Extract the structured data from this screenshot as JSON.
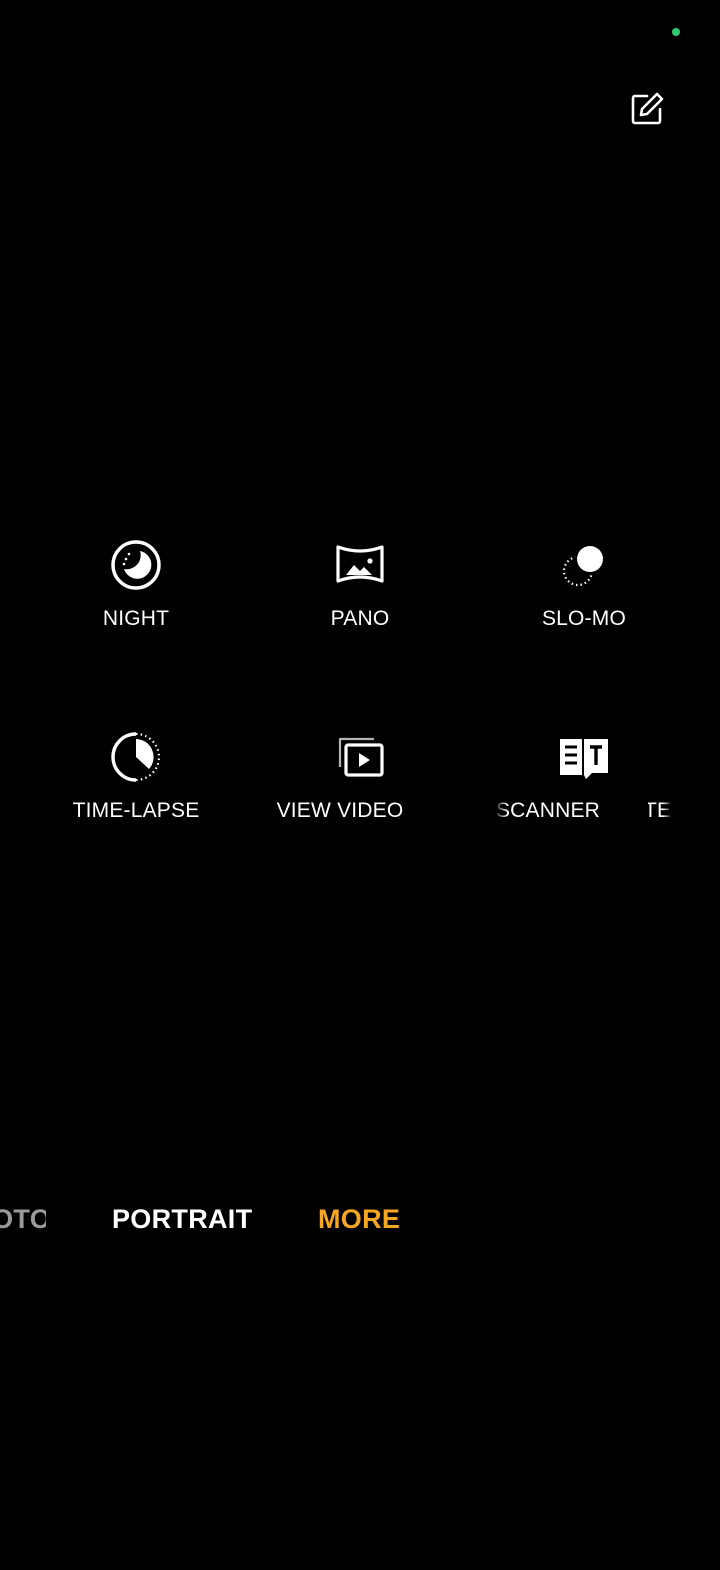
{
  "colors": {
    "background": "#000000",
    "text": "#ffffff",
    "accent": "#f5a623",
    "dim": "#9a9a9a",
    "status_dot": "#2ecc71"
  },
  "status_indicator": {
    "icon": "status-dot-icon"
  },
  "toolbar": {
    "edit_icon": "edit-icon"
  },
  "more_modes": {
    "row1": [
      {
        "label": "NIGHT",
        "icon": "night-icon"
      },
      {
        "label": "PANO",
        "icon": "pano-icon"
      },
      {
        "label": "SLO-MO",
        "icon": "slo-mo-icon"
      }
    ],
    "row2": [
      {
        "label": "TIME-LAPSE",
        "icon": "time-lapse-icon"
      },
      {
        "label": "VIEW VIDEO",
        "icon": "view-video-icon"
      },
      {
        "label": "SCANNER",
        "icon": "scanner-icon"
      },
      {
        "label": "TEXT",
        "icon": "text-icon"
      }
    ]
  },
  "mode_bar": {
    "items": [
      {
        "label": "PHOTO"
      },
      {
        "label": "PORTRAIT"
      },
      {
        "label": "MORE"
      }
    ],
    "selected": "MORE"
  }
}
